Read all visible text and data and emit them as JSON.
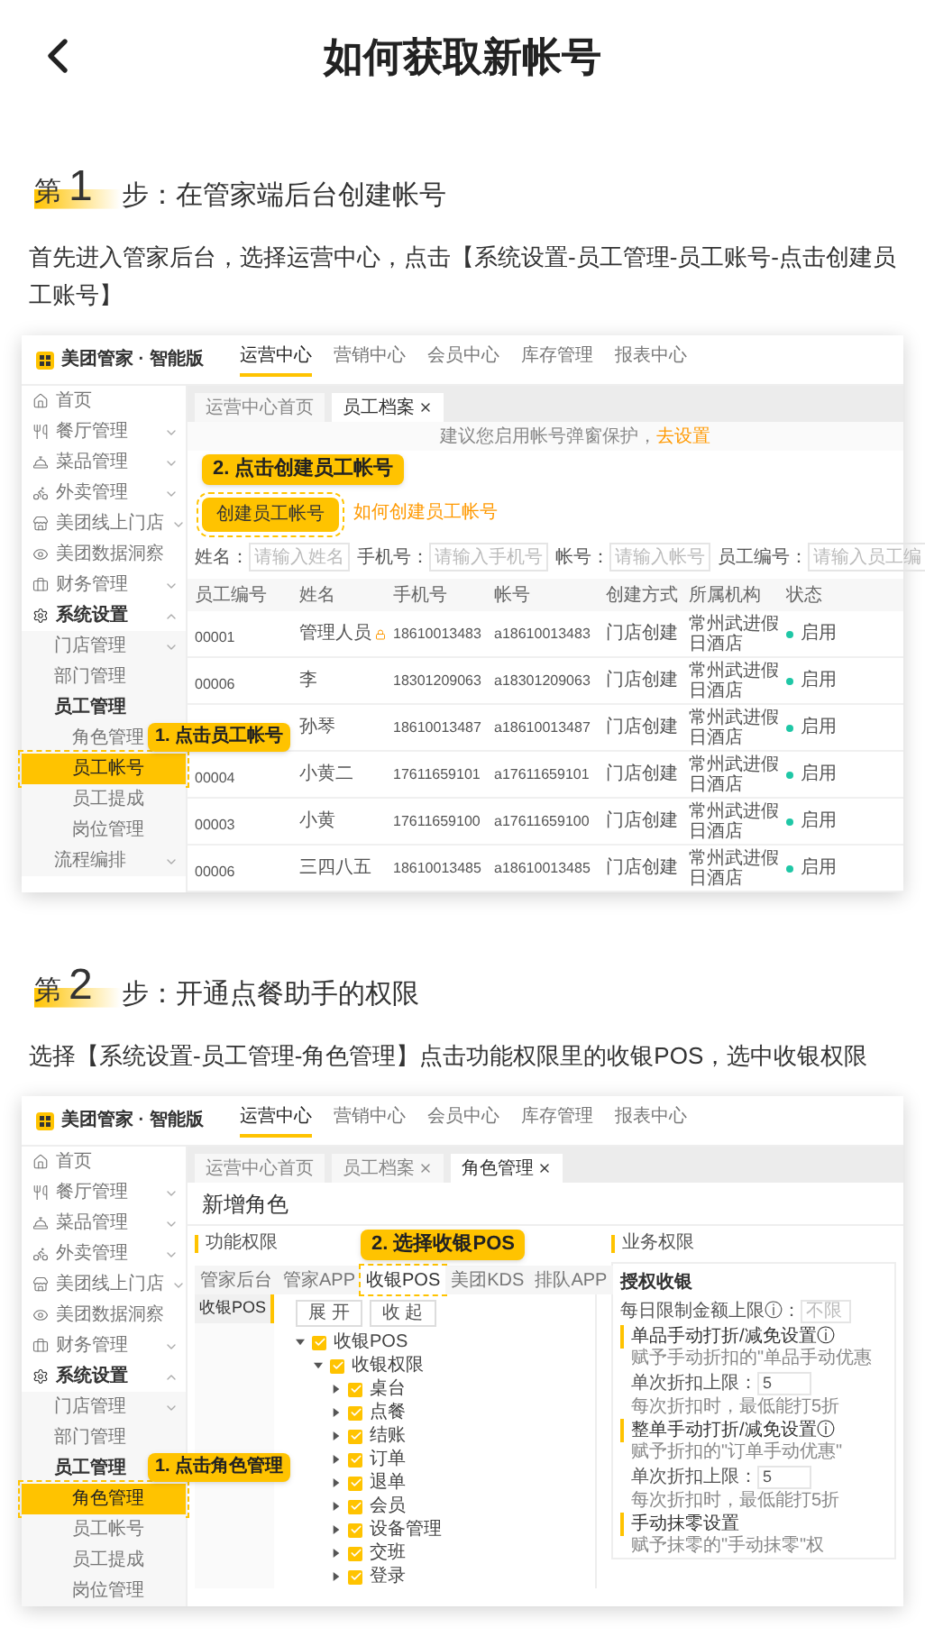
{
  "header": {
    "title": "如何获取新帐号"
  },
  "steps": [
    {
      "prefix": "第",
      "number": "1",
      "suffix": "步：在管家端后台创建帐号",
      "description": "首先进入管家后台，选择运营中心，点击【系统设置-员工管理-员工账号-点击创建员工账号】",
      "screenshot": {
        "kind": "staff_accounts",
        "brand": "美团管家 · 智能版",
        "nav": [
          {
            "label": "运营中心",
            "selected": true
          },
          {
            "label": "营销中心",
            "selected": false
          },
          {
            "label": "会员中心",
            "selected": false
          },
          {
            "label": "库存管理",
            "selected": false
          },
          {
            "label": "报表中心",
            "selected": false
          }
        ],
        "sidebar": [
          {
            "label": "首页",
            "selected": false
          },
          {
            "label": "餐厅管理",
            "selected": false,
            "expanded": false
          },
          {
            "label": "菜品管理",
            "selected": false,
            "expanded": false
          },
          {
            "label": "外卖管理",
            "selected": false,
            "expanded": false
          },
          {
            "label": "美团线上门店",
            "selected": false,
            "expanded": false
          },
          {
            "label": "美团数据洞察",
            "selected": false
          },
          {
            "label": "财务管理",
            "selected": false,
            "expanded": false
          },
          {
            "label": "系统设置",
            "selected": false,
            "expanded": true,
            "children": [
              {
                "label": "门店管理",
                "selected": false,
                "expanded": false
              },
              {
                "label": "部门管理",
                "selected": false
              },
              {
                "label": "员工管理",
                "selected": false,
                "children": [
                  {
                    "label": "角色管理",
                    "selected": false
                  },
                  {
                    "label": "员工帐号",
                    "selected": true,
                    "callout": "1. 点击员工帐号"
                  },
                  {
                    "label": "员工提成",
                    "selected": false
                  },
                  {
                    "label": "岗位管理",
                    "selected": false
                  }
                ]
              },
              {
                "label": "流程编排",
                "selected": false,
                "expanded": false
              }
            ]
          }
        ],
        "page_tabs": [
          {
            "label": "运营中心首页",
            "selected": false,
            "closable": false
          },
          {
            "label": "员工档案",
            "selected": true,
            "closable": true
          }
        ],
        "notice": {
          "text": "建议您启用帐号弹窗保护，",
          "link": "去设置"
        },
        "create_button": {
          "label": "创建员工帐号",
          "callout": "2. 点击创建员工帐号"
        },
        "help_link": "如何创建员工帐号",
        "filters": [
          {
            "label": "姓名：",
            "placeholder": "请输入姓名"
          },
          {
            "label": "手机号：",
            "placeholder": "请输入手机号"
          },
          {
            "label": "帐号：",
            "placeholder": "请输入帐号"
          },
          {
            "label": "员工编号：",
            "placeholder": "请输入员工编"
          }
        ],
        "table": {
          "columns": [
            "员工编号",
            "姓名",
            "手机号",
            "帐号",
            "创建方式",
            "所属机构",
            "状态"
          ],
          "rows": [
            {
              "id": "00001",
              "name": "管理人员",
              "locked": true,
              "phone": "18610013483",
              "account": "a18610013483",
              "method": "门店创建",
              "org": "常州武进假日酒店",
              "status": "启用",
              "enabled": true
            },
            {
              "id": "00006",
              "name": "李",
              "locked": false,
              "phone": "18301209063",
              "account": "a18301209063",
              "method": "门店创建",
              "org": "常州武进假日酒店",
              "status": "启用",
              "enabled": true
            },
            {
              "name": "孙琴",
              "locked": false,
              "phone": "18610013487",
              "account": "a18610013487",
              "method": "门店创建",
              "org": "常州武进假日酒店",
              "status": "启用",
              "enabled": true
            },
            {
              "id": "00004",
              "name": "小黄二",
              "locked": false,
              "phone": "17611659101",
              "account": "a17611659101",
              "method": "门店创建",
              "org": "常州武进假日酒店",
              "status": "启用",
              "enabled": true
            },
            {
              "id": "00003",
              "name": "小黄",
              "locked": false,
              "phone": "17611659100",
              "account": "a17611659100",
              "method": "门店创建",
              "org": "常州武进假日酒店",
              "status": "启用",
              "enabled": true
            },
            {
              "id": "00006",
              "name": "三四八五",
              "locked": false,
              "phone": "18610013485",
              "account": "a18610013485",
              "method": "门店创建",
              "org": "常州武进假日酒店",
              "status": "启用",
              "enabled": true
            }
          ]
        }
      }
    },
    {
      "prefix": "第",
      "number": "2",
      "suffix": "步：开通点餐助手的权限",
      "description": "选择【系统设置-员工管理-角色管理】点击功能权限里的收银POS，选中收银权限",
      "screenshot": {
        "kind": "role_permissions",
        "brand": "美团管家 · 智能版",
        "nav": [
          {
            "label": "运营中心",
            "selected": true
          },
          {
            "label": "营销中心",
            "selected": false
          },
          {
            "label": "会员中心",
            "selected": false
          },
          {
            "label": "库存管理",
            "selected": false
          },
          {
            "label": "报表中心",
            "selected": false
          }
        ],
        "sidebar": [
          {
            "label": "首页",
            "selected": false
          },
          {
            "label": "餐厅管理",
            "selected": false,
            "expanded": false
          },
          {
            "label": "菜品管理",
            "selected": false,
            "expanded": false
          },
          {
            "label": "外卖管理",
            "selected": false,
            "expanded": false
          },
          {
            "label": "美团线上门店",
            "selected": false,
            "expanded": false
          },
          {
            "label": "美团数据洞察",
            "selected": false
          },
          {
            "label": "财务管理",
            "selected": false,
            "expanded": false
          },
          {
            "label": "系统设置",
            "selected": false,
            "expanded": true,
            "children": [
              {
                "label": "门店管理",
                "selected": false,
                "expanded": false
              },
              {
                "label": "部门管理",
                "selected": false
              },
              {
                "label": "员工管理",
                "selected": false,
                "children": [
                  {
                    "label": "角色管理",
                    "selected": true,
                    "callout": "1. 点击角色管理"
                  },
                  {
                    "label": "员工帐号",
                    "selected": false
                  },
                  {
                    "label": "员工提成",
                    "selected": false
                  },
                  {
                    "label": "岗位管理",
                    "selected": false
                  }
                ]
              }
            ]
          }
        ],
        "page_tabs": [
          {
            "label": "运营中心首页",
            "selected": false,
            "closable": false
          },
          {
            "label": "员工档案",
            "selected": false,
            "closable": true
          },
          {
            "label": "角色管理",
            "selected": true,
            "closable": true
          }
        ],
        "page_title": "新增角色",
        "function_permissions": {
          "title": "功能权限",
          "tabs": [
            {
              "label": "管家后台",
              "selected": false
            },
            {
              "label": "管家APP",
              "selected": false
            },
            {
              "label": "收银POS",
              "selected": true,
              "callout": "2. 选择收银POS"
            },
            {
              "label": "美团KDS",
              "selected": false
            },
            {
              "label": "排队APP",
              "selected": false
            }
          ],
          "groups": [
            {
              "label": "收银POS",
              "selected": true
            }
          ],
          "buttons": [
            "展 开",
            "收 起"
          ],
          "tree": [
            {
              "label": "收银POS",
              "checked": true,
              "expanded": true,
              "children": [
                {
                  "label": "收银权限",
                  "checked": true,
                  "expanded": true,
                  "children": [
                    {
                      "label": "桌台",
                      "checked": true,
                      "expanded": false
                    },
                    {
                      "label": "点餐",
                      "checked": true,
                      "expanded": false
                    },
                    {
                      "label": "结账",
                      "checked": true,
                      "expanded": false
                    },
                    {
                      "label": "订单",
                      "checked": true,
                      "expanded": false
                    },
                    {
                      "label": "退单",
                      "checked": true,
                      "expanded": false
                    },
                    {
                      "label": "会员",
                      "checked": true,
                      "expanded": false
                    },
                    {
                      "label": "设备管理",
                      "checked": true,
                      "expanded": false
                    },
                    {
                      "label": "交班",
                      "checked": true,
                      "expanded": false
                    },
                    {
                      "label": "登录",
                      "checked": true,
                      "expanded": false
                    }
                  ]
                }
              ]
            }
          ]
        },
        "business_permissions": {
          "title": "业务权限",
          "section_title": "授权收银",
          "limit": {
            "label": "每日限制金额上限ⓘ：",
            "placeholder": "不限"
          },
          "settings": [
            {
              "title": "单品手动打折/减免设置ⓘ",
              "note": "赋予手动折扣的\"单品手动优惠",
              "field": {
                "label": "单次折扣上限：",
                "value": "5"
              },
              "hint": "每次折扣时，最低能打5折"
            },
            {
              "title": "整单手动打折/减免设置ⓘ",
              "note": "赋予折扣的\"订单手动优惠\"",
              "field": {
                "label": "单次折扣上限：",
                "value": "5"
              },
              "hint": "每次折扣时，最低能打5折"
            },
            {
              "title": "手动抹零设置",
              "note": "赋予抹零的\"手动抹零\"权"
            }
          ]
        }
      }
    }
  ]
}
